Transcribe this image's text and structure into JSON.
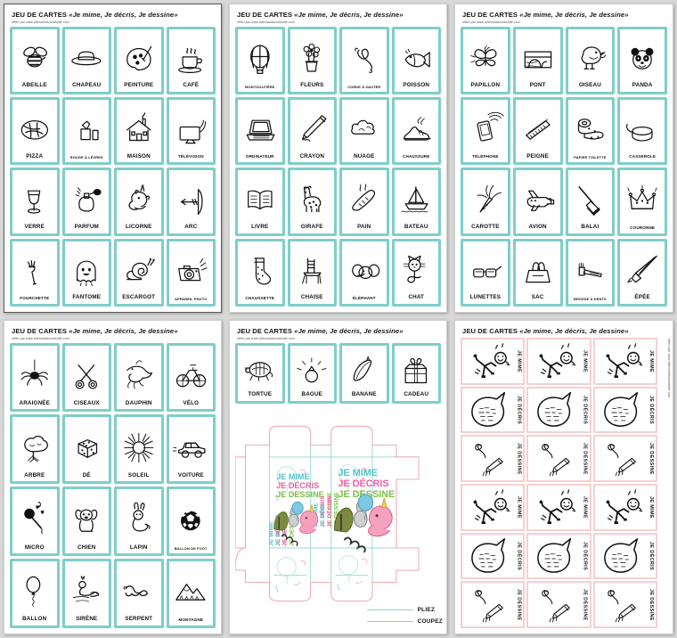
{
  "document": {
    "title_main": "JEU DE CARTES",
    "title_quote": "«Je mime, Je décris, Je dessine»",
    "subtitle": "offert par www.allemandsnordslide.com",
    "colors": {
      "card_border_teal": "#7ececa",
      "role_card_border_pink": "#f6cfd2",
      "fold_line_blue": "#8ed4d2",
      "cut_line_pink": "#f0a0ac",
      "page_background": "#ffffff",
      "sheet_background": "#d8d8d8"
    }
  },
  "pages": [
    {
      "index": 1,
      "cards": [
        {
          "label": "ABEILLE",
          "icon": "bee-icon",
          "size": "normal"
        },
        {
          "label": "CHAPEAU",
          "icon": "hat-icon",
          "size": "normal"
        },
        {
          "label": "PEINTURE",
          "icon": "paint-palette-icon",
          "size": "normal"
        },
        {
          "label": "CAFÉ",
          "icon": "coffee-cup-icon",
          "size": "normal"
        },
        {
          "label": "PIZZA",
          "icon": "pizza-icon",
          "size": "normal"
        },
        {
          "label": "ROUGE À LÈVRES",
          "icon": "lipstick-icon",
          "size": "xs"
        },
        {
          "label": "MAISON",
          "icon": "house-icon",
          "size": "normal"
        },
        {
          "label": "TÉLÉVISION",
          "icon": "television-icon",
          "size": "sm"
        },
        {
          "label": "VERRE",
          "icon": "wine-glass-icon",
          "size": "normal"
        },
        {
          "label": "PARFUM",
          "icon": "perfume-icon",
          "size": "normal"
        },
        {
          "label": "LICORNE",
          "icon": "unicorn-icon",
          "size": "normal"
        },
        {
          "label": "ARC",
          "icon": "bow-arrow-icon",
          "size": "normal"
        },
        {
          "label": "FOURCHETTE",
          "icon": "fork-icon",
          "size": "sm"
        },
        {
          "label": "FANTOME",
          "icon": "ghost-icon",
          "size": "normal"
        },
        {
          "label": "ESCARGOT",
          "icon": "snail-icon",
          "size": "normal"
        },
        {
          "label": "APPAREIL PHOTO",
          "icon": "camera-icon",
          "size": "xs"
        }
      ]
    },
    {
      "index": 2,
      "cards": [
        {
          "label": "MONTGOLFIÈRE",
          "icon": "hot-air-balloon-icon",
          "size": "xs"
        },
        {
          "label": "FLEURS",
          "icon": "flowers-icon",
          "size": "normal"
        },
        {
          "label": "CORDE À SAUTER",
          "icon": "jump-rope-icon",
          "size": "xs"
        },
        {
          "label": "POISSON",
          "icon": "fish-icon",
          "size": "normal"
        },
        {
          "label": "ORDINATEUR",
          "icon": "laptop-icon",
          "size": "sm"
        },
        {
          "label": "CRAYON",
          "icon": "pencil-icon",
          "size": "normal"
        },
        {
          "label": "NUAGE",
          "icon": "cloud-icon",
          "size": "normal"
        },
        {
          "label": "CHAUSSURE",
          "icon": "shoe-icon",
          "size": "sm"
        },
        {
          "label": "LIVRE",
          "icon": "book-icon",
          "size": "normal"
        },
        {
          "label": "GIRAFE",
          "icon": "giraffe-icon",
          "size": "normal"
        },
        {
          "label": "PAIN",
          "icon": "bread-baguette-icon",
          "size": "normal"
        },
        {
          "label": "BATEAU",
          "icon": "sailboat-icon",
          "size": "normal"
        },
        {
          "label": "CHAUSSETTE",
          "icon": "sock-icon",
          "size": "sm"
        },
        {
          "label": "CHAISE",
          "icon": "chair-icon",
          "size": "normal"
        },
        {
          "label": "ÉLÉPHANT",
          "icon": "elephant-icon",
          "size": "sm"
        },
        {
          "label": "CHAT",
          "icon": "cat-icon",
          "size": "normal"
        }
      ]
    },
    {
      "index": 3,
      "cards": [
        {
          "label": "PAPILLON",
          "icon": "butterfly-icon",
          "size": "normal"
        },
        {
          "label": "PONT",
          "icon": "bridge-icon",
          "size": "normal"
        },
        {
          "label": "OISEAU",
          "icon": "bird-icon",
          "size": "normal"
        },
        {
          "label": "PANDA",
          "icon": "panda-icon",
          "size": "normal"
        },
        {
          "label": "TÉLÉPHONE",
          "icon": "mobile-phone-icon",
          "size": "sm"
        },
        {
          "label": "PEIGNE",
          "icon": "comb-icon",
          "size": "normal"
        },
        {
          "label": "PAPIER TOILETTE",
          "icon": "toilet-paper-icon",
          "size": "xs"
        },
        {
          "label": "CASSEROLE",
          "icon": "saucepan-icon",
          "size": "sm"
        },
        {
          "label": "CAROTTE",
          "icon": "carrot-icon",
          "size": "normal"
        },
        {
          "label": "AVION",
          "icon": "airplane-icon",
          "size": "normal"
        },
        {
          "label": "BALAI",
          "icon": "broom-icon",
          "size": "normal"
        },
        {
          "label": "COURONNE",
          "icon": "crown-icon",
          "size": "sm"
        },
        {
          "label": "LUNETTES",
          "icon": "glasses-icon",
          "size": "normal"
        },
        {
          "label": "SAC",
          "icon": "handbag-icon",
          "size": "normal"
        },
        {
          "label": "BROSSE À DENTS",
          "icon": "toothbrush-icon",
          "size": "xs"
        },
        {
          "label": "ÉPÉE",
          "icon": "sword-icon",
          "size": "normal"
        }
      ]
    },
    {
      "index": 4,
      "cards": [
        {
          "label": "ARAIGNÉE",
          "icon": "spider-icon",
          "size": "normal"
        },
        {
          "label": "CISEAUX",
          "icon": "scissors-icon",
          "size": "normal"
        },
        {
          "label": "DAUPHIN",
          "icon": "dolphin-icon",
          "size": "normal"
        },
        {
          "label": "VÉLO",
          "icon": "bicycle-icon",
          "size": "normal"
        },
        {
          "label": "ARBRE",
          "icon": "tree-icon",
          "size": "normal"
        },
        {
          "label": "DÉ",
          "icon": "dice-icon",
          "size": "normal"
        },
        {
          "label": "SOLEIL",
          "icon": "sun-icon",
          "size": "normal"
        },
        {
          "label": "VOITURE",
          "icon": "car-icon",
          "size": "normal"
        },
        {
          "label": "MICRO",
          "icon": "microphone-icon",
          "size": "normal"
        },
        {
          "label": "CHIEN",
          "icon": "dog-icon",
          "size": "normal"
        },
        {
          "label": "LAPIN",
          "icon": "rabbit-icon",
          "size": "normal"
        },
        {
          "label": "BALLON DE FOOT",
          "icon": "soccer-ball-icon",
          "size": "xs"
        },
        {
          "label": "BALLON",
          "icon": "balloon-icon",
          "size": "normal"
        },
        {
          "label": "SIRÈNE",
          "icon": "mermaid-icon",
          "size": "normal"
        },
        {
          "label": "SERPENT",
          "icon": "snake-icon",
          "size": "normal"
        },
        {
          "label": "MONTAGNE",
          "icon": "mountain-icon",
          "size": "sm"
        }
      ]
    },
    {
      "index": 5,
      "cards": [
        {
          "label": "TORTUE",
          "icon": "turtle-icon",
          "size": "normal"
        },
        {
          "label": "BAGUE",
          "icon": "ring-icon",
          "size": "normal"
        },
        {
          "label": "BANANE",
          "icon": "banana-icon",
          "size": "normal"
        },
        {
          "label": "CADEAU",
          "icon": "gift-icon",
          "size": "normal"
        }
      ],
      "box_template": {
        "panel_text_lines": [
          "JE MIME",
          "JE DÉCRIS",
          "JE DESSINE"
        ],
        "panel_text_colors": [
          "#4ec3c8",
          "#ef5fa0",
          "#7ac143"
        ],
        "legend": [
          {
            "label": "PLIEZ",
            "color": "#8ed4d2",
            "meaning": "fold-line"
          },
          {
            "label": "COUPEZ",
            "color": "#f0a0ac",
            "meaning": "cut-line"
          }
        ]
      }
    },
    {
      "index": 6,
      "role_rows": [
        {
          "label": "JE MIME",
          "icon": "stick-figure-mime-icon"
        },
        {
          "label": "JE DÉCRIS",
          "icon": "speech-bubble-icon"
        },
        {
          "label": "JE DESSINE",
          "icon": "pencil-scribble-icon"
        },
        {
          "label": "JE MIME",
          "icon": "stick-figure-mime-icon"
        },
        {
          "label": "JE DÉCRIS",
          "icon": "speech-bubble-icon"
        },
        {
          "label": "JE DESSINE",
          "icon": "pencil-scribble-icon"
        }
      ],
      "columns": 3
    }
  ]
}
